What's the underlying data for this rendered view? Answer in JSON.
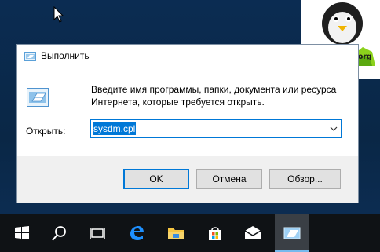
{
  "dialog": {
    "title": "Выполнить",
    "description": "Введите имя программы, папки, документа или ресурса Интернета, которые требуется открыть.",
    "open_label": "Открыть:",
    "open_value": "sysdm.cpl",
    "buttons": {
      "ok": "OK",
      "cancel": "Отмена",
      "browse": "Обзор..."
    }
  },
  "watermark": {
    "text": "pyatilistnik.org"
  },
  "taskbar": {
    "items": [
      "start-icon",
      "search-icon",
      "task-view-icon",
      "edge-icon",
      "file-explorer-icon",
      "store-icon",
      "mail-icon",
      "run-icon"
    ]
  },
  "colors": {
    "accent": "#0078d7",
    "taskbar": "#0f1215",
    "desktop": "#0b2c52"
  }
}
